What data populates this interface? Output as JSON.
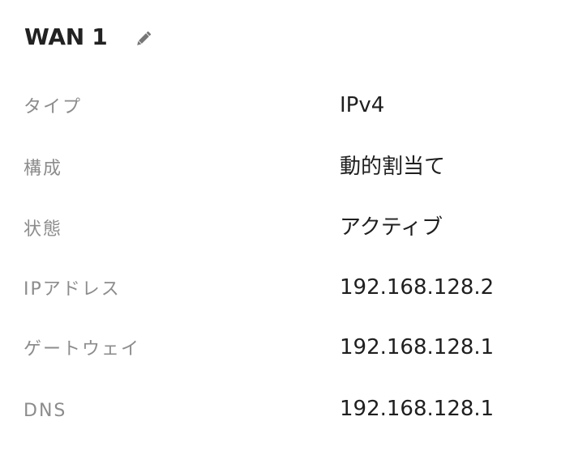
{
  "header": {
    "title": "WAN 1",
    "edit_icon": "pencil-icon"
  },
  "details": [
    {
      "label": "タイプ",
      "value": "IPv4"
    },
    {
      "label": "構成",
      "value": "動的割当て"
    },
    {
      "label": "状態",
      "value": "アクティブ"
    },
    {
      "label": "IPアドレス",
      "value": "192.168.128.2"
    },
    {
      "label": "ゲートウェイ",
      "value": "192.168.128.1"
    },
    {
      "label": "DNS",
      "value": "192.168.128.1"
    }
  ],
  "colors": {
    "title": "#222222",
    "label": "#8c8c8c",
    "value": "#1f1f1f",
    "icon": "#777777"
  }
}
